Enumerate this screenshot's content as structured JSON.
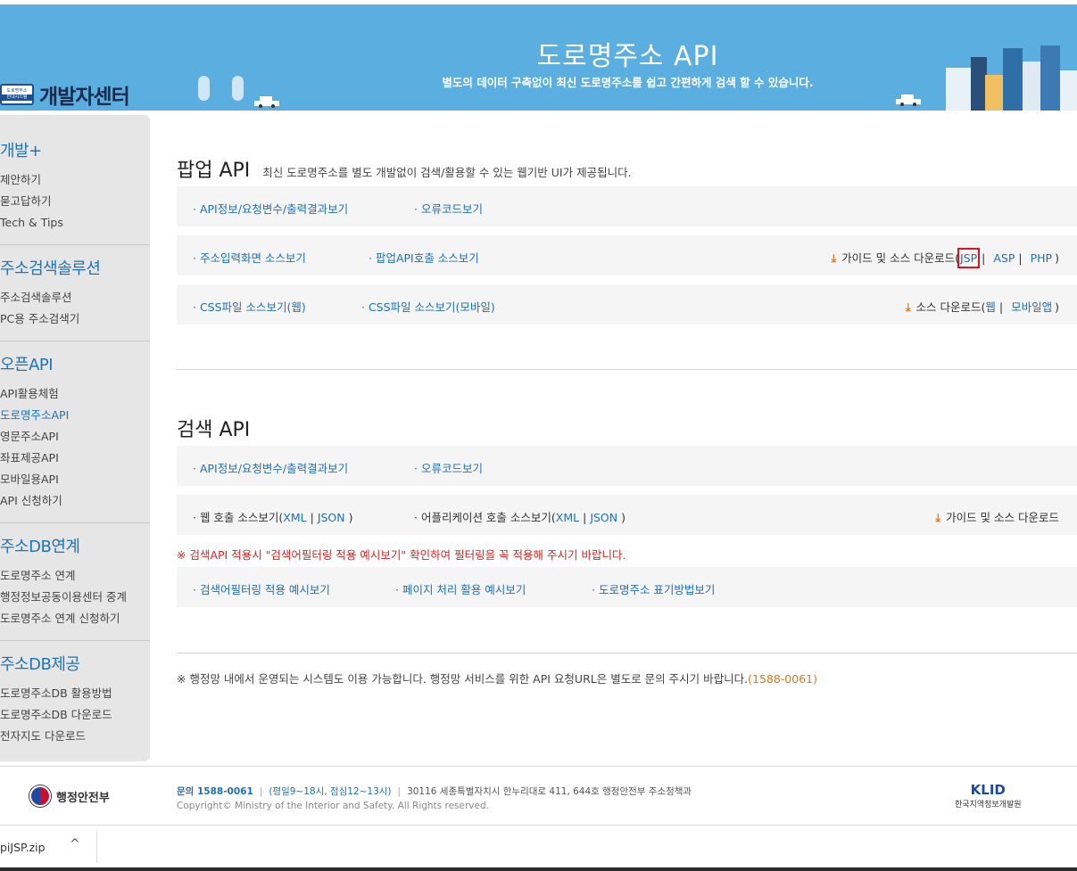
{
  "header": {
    "logo_badge_line1": "도로명주소",
    "logo_badge_line2": "안내시스템",
    "logo_text": "개발자센터",
    "title": "도로명주소 API",
    "subtitle": "별도의 데이터 구축없이 최신 도로명주소를 쉽고 간편하게 검색 할 수 있습니다."
  },
  "sidebar": {
    "groups": [
      {
        "title": "개발+",
        "items": [
          "제안하기",
          "묻고답하기",
          "Tech & Tips"
        ]
      },
      {
        "title": "주소검색솔루션",
        "items": [
          "주소검색솔루션",
          "PC용 주소검색기"
        ]
      },
      {
        "title": "오픈API",
        "items": [
          "API활용체험",
          "도로명주소API",
          "영문주소API",
          "좌표제공API",
          "모바일용API",
          "API 신청하기"
        ],
        "active_index": 1
      },
      {
        "title": "주소DB연계",
        "items": [
          "도로명주소 연계",
          "행정정보공동이용센터 중계",
          "도로명주소 연계 신청하기"
        ]
      },
      {
        "title": "주소DB제공",
        "items": [
          "도로명주소DB 활용방법",
          "도로명주소DB 다운로드",
          "전자지도 다운로드"
        ]
      }
    ]
  },
  "popup_api": {
    "title": "팝업 API",
    "desc": "최신 도로명주소를 별도 개발없이 검색/활용할 수 있는 웹기반 UI가 제공됩니다.",
    "row1": {
      "link1": "· API정보/요청변수/출력결과보기",
      "link2": "· 오류코드보기"
    },
    "row2": {
      "link1": "· 주소입력화면 소스보기",
      "link2": "· 팝업API호출 소스보기",
      "guide_label": "가이드 및 소스 다운로드(",
      "jsp": "JSP",
      "sep1": "|",
      "asp": "ASP",
      "sep2": "|",
      "php": "PHP",
      "close": ")"
    },
    "row3": {
      "link1": "· CSS파일 소스보기(웹)",
      "link2": "· CSS파일 소스보기(모바일)",
      "download_label": "소스 다운로드(",
      "web": "웹",
      "sep": "|",
      "mobile": "모바일앱",
      "close": ")"
    }
  },
  "search_api": {
    "title": "검색 API",
    "row1": {
      "link1": "· API정보/요청변수/출력결과보기",
      "link2": "· 오류코드보기"
    },
    "row2": {
      "web_call_label": "· 웹 호출 소스보기(",
      "xml": "XML",
      "sep": "|",
      "json": "JSON",
      "close": ")",
      "app_call_label": "· 어플리케이션 호출 소스보기(",
      "guide_label": "가이드 및 소스 다운로드"
    },
    "warning": "※ 검색API 적용시 \"검색어필터링 적용 예시보기\" 확인하여 필터링을 꼭 적용해 주시기 바랍니다.",
    "row3": {
      "link1": "· 검색어필터링 적용 예시보기",
      "link2": "· 페이지 처리 활용 예시보기",
      "link3": "· 도로명주소 표기방법보기"
    }
  },
  "note": {
    "text": "※ 행정망 내에서 운영되는 시스템도 이용 가능합니다. 행정망 서비스를 위한 API 요청URL은 별도로 문의 주시기 바랍니다.",
    "phone": "(1588-0061)"
  },
  "footer": {
    "ministry": "행정안전부",
    "tel": "문의 1588-0061",
    "hours": "(평일9~18시, 점심12~13시)",
    "address": "30116 세종특별자치시 한누리대로 411, 644호 행정안전부 주소정책과",
    "copyright": "Copyright© Ministry of the Interior and Safety. All Rights reserved.",
    "klid_mark": "KLID",
    "klid_name": "한국지역정보개발원"
  },
  "download_bar": {
    "filename": "piJSP.zip",
    "chevron": "^"
  },
  "icons": {
    "download": "download-icon",
    "chevron": "chevron-up-icon"
  },
  "colors": {
    "header_bg": "#5aaee0",
    "link": "#1f6fb5",
    "warning": "#e02020",
    "highlight": "#e0101e",
    "download_icon": "#e07a1f"
  }
}
